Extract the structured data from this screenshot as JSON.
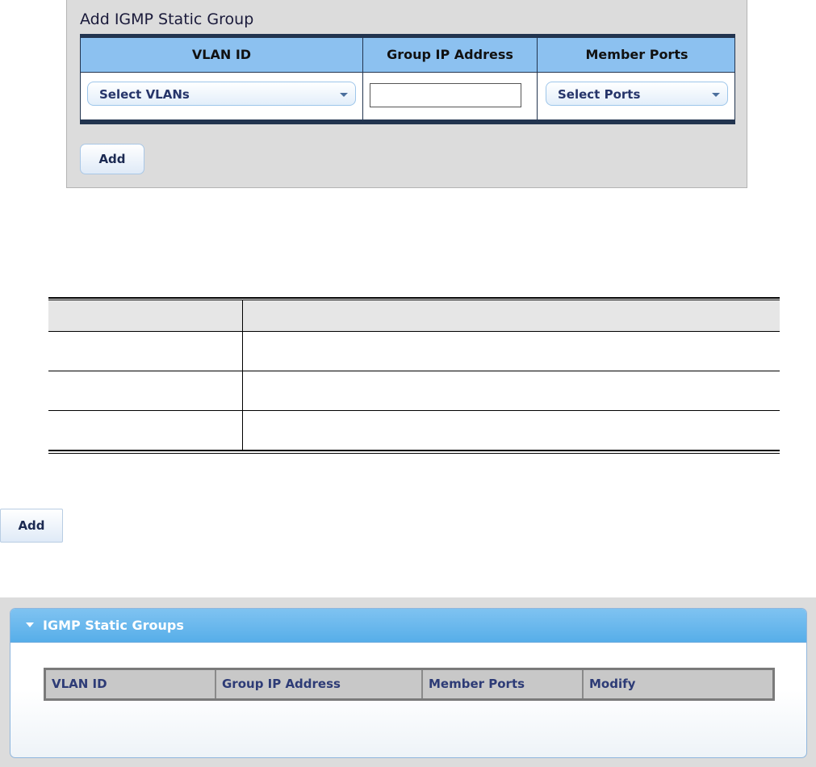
{
  "add_group": {
    "title": "Add IGMP Static Group",
    "columns": [
      "VLAN ID",
      "Group IP Address",
      "Member Ports"
    ],
    "vlan_select": "Select VLANs",
    "group_ip_value": "",
    "ports_select": "Select Ports",
    "add_label": "Add"
  },
  "description_table": {
    "headers": [
      "",
      ""
    ],
    "rows": [
      [
        "",
        ""
      ],
      [
        "",
        ""
      ],
      [
        "",
        ""
      ]
    ]
  },
  "standalone_add_label": "Add",
  "static_groups": {
    "title": "IGMP Static Groups",
    "columns": [
      "VLAN ID",
      "Group IP Address",
      "Member Ports",
      "Modify"
    ]
  }
}
